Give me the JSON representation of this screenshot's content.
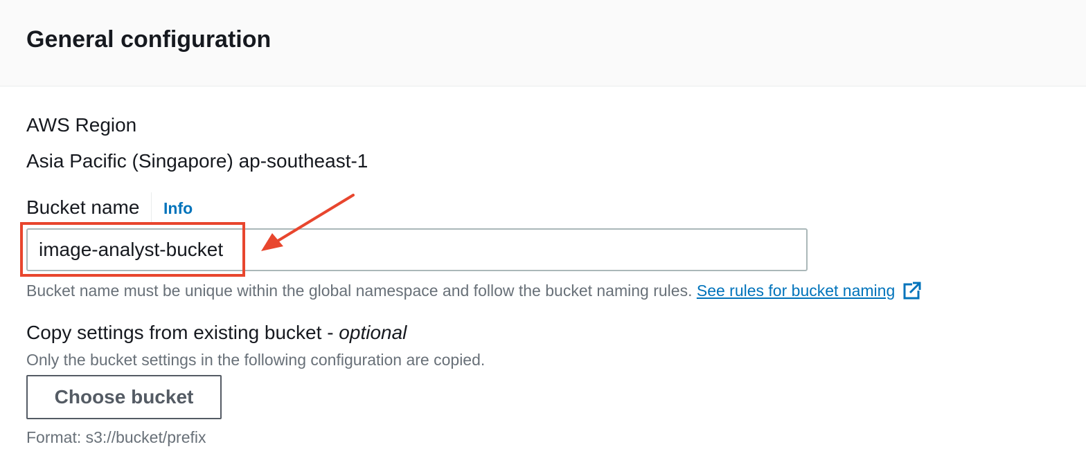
{
  "section": {
    "title": "General configuration"
  },
  "region": {
    "label": "AWS Region",
    "value": "Asia Pacific (Singapore) ap-southeast-1"
  },
  "bucket_name": {
    "label": "Bucket name",
    "info_link": "Info",
    "value": "image-analyst-bucket",
    "hint": "Bucket name must be unique within the global namespace and follow the bucket naming rules.",
    "rules_link": "See rules for bucket naming"
  },
  "copy_settings": {
    "label": "Copy settings from existing bucket - ",
    "label_optional": "optional",
    "description": "Only the bucket settings in the following configuration are copied.",
    "button_label": "Choose bucket",
    "format_hint": "Format: s3://bucket/prefix"
  },
  "colors": {
    "link": "#0073bb",
    "annotation": "#e8462e",
    "muted_text": "#687078"
  },
  "icons": {
    "external_link": "external-link-icon",
    "annotation_arrow": "arrow-icon"
  }
}
